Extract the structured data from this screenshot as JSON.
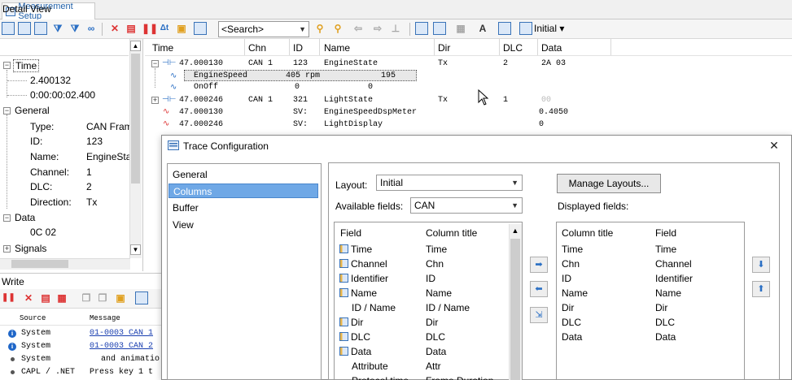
{
  "tab": {
    "label": "Measurement Setup"
  },
  "toolbar": {
    "search_placeholder": "<Search>",
    "layout": "Initial",
    "icons": [
      "detail-view-icon",
      "filter-icon",
      "binoculars-icon",
      "delete-icon",
      "pause-icon",
      "stop-icon",
      "time-icon",
      "export-icon",
      "toggle-icon",
      "find-next-icon",
      "find-prev-icon",
      "nav-back-icon",
      "nav-forward-icon",
      "copy-icon",
      "columns-icon",
      "font-icon",
      "layout-icon"
    ]
  },
  "detail_view": {
    "title": "Detail View",
    "time_group": "Time",
    "time_value": "2.400132",
    "time_delta": "0:00:00:02.400",
    "general_group": "General",
    "type_label": "Type:",
    "type_value": "CAN Fram",
    "id_label": "ID:",
    "id_value": "123",
    "name_label": "Name:",
    "name_value": "EngineSta",
    "channel_label": "Channel:",
    "channel_value": "1",
    "dlc_label": "DLC:",
    "dlc_value": "2",
    "direction_label": "Direction:",
    "direction_value": "Tx",
    "data_group": "Data",
    "data_value": "0C 02",
    "signals_group": "Signals"
  },
  "trace": {
    "headers": {
      "time": "Time",
      "chn": "Chn",
      "id": "ID",
      "name": "Name",
      "dir": "Dir",
      "dlc": "DLC",
      "data": "Data"
    },
    "rows": [
      {
        "time": "47.000130",
        "chn": "CAN 1",
        "id": "123",
        "name": "EngineState",
        "dir": "Tx",
        "dlc": "2",
        "data": "2A 03"
      },
      {
        "signal": "EngineSpeed",
        "value": "405 rpm",
        "raw": "195"
      },
      {
        "signal": "OnOff",
        "value": "0",
        "raw": "0"
      },
      {
        "time": "47.000246",
        "chn": "CAN 1",
        "id": "321",
        "name": "LightState",
        "dir": "Tx",
        "dlc": "1",
        "data": "00"
      },
      {
        "time": "47.000130",
        "chn": "SV:",
        "name": "EngineSpeedDspMeter",
        "data": "0.4050"
      },
      {
        "time": "47.000246",
        "chn": "SV:",
        "name": "LightDisplay",
        "data": "0"
      }
    ]
  },
  "write": {
    "title": "Write",
    "col_source": "Source",
    "col_message": "Message",
    "lines": [
      {
        "source": "System",
        "message": "01-0003 CAN 1"
      },
      {
        "source": "System",
        "message": "01-0003 CAN 2"
      },
      {
        "source": "System",
        "message": "and animatio"
      },
      {
        "source": "CAPL / .NET",
        "message": "Press key 1 t"
      }
    ]
  },
  "dialog": {
    "title": "Trace Configuration",
    "nav": [
      "General",
      "Columns",
      "Buffer",
      "View"
    ],
    "layout_label": "Layout:",
    "layout_value": "Initial",
    "manage_button": "Manage Layouts...",
    "available_label": "Available fields:",
    "available_value": "CAN",
    "displayed_label": "Displayed fields:",
    "available_headers": {
      "field": "Field",
      "title": "Column title"
    },
    "available": [
      {
        "field": "Time",
        "title": "Time",
        "icon": true
      },
      {
        "field": "Channel",
        "title": "Chn",
        "icon": true
      },
      {
        "field": "Identifier",
        "title": "ID",
        "icon": true
      },
      {
        "field": "Name",
        "title": "Name",
        "icon": true
      },
      {
        "field": "ID / Name",
        "title": "ID / Name",
        "icon": false
      },
      {
        "field": "Dir",
        "title": "Dir",
        "icon": true
      },
      {
        "field": "DLC",
        "title": "DLC",
        "icon": true
      },
      {
        "field": "Data",
        "title": "Data",
        "icon": true
      },
      {
        "field": "Attribute",
        "title": "Attr",
        "icon": false
      },
      {
        "field": "Protocol time",
        "title": "Frame Duration",
        "icon": false
      }
    ],
    "displayed_headers": {
      "title": "Column title",
      "field": "Field"
    },
    "displayed": [
      {
        "title": "Time",
        "field": "Time"
      },
      {
        "title": "Chn",
        "field": "Channel"
      },
      {
        "title": "ID",
        "field": "Identifier"
      },
      {
        "title": "Name",
        "field": "Name"
      },
      {
        "title": "Dir",
        "field": "Dir"
      },
      {
        "title": "DLC",
        "field": "DLC"
      },
      {
        "title": "Data",
        "field": "Data"
      }
    ]
  }
}
